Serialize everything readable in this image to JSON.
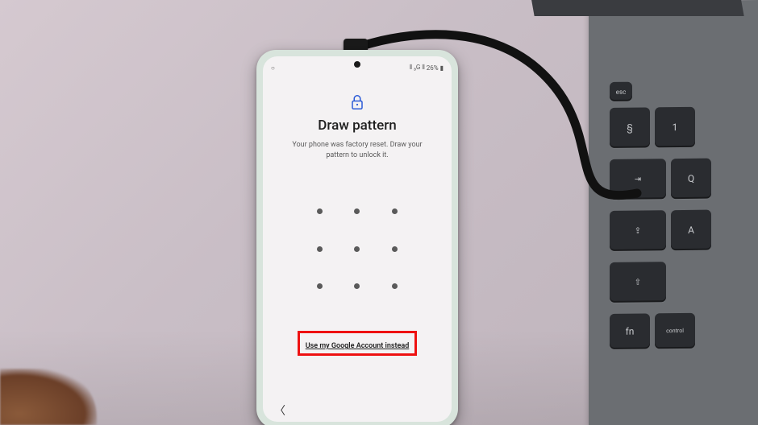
{
  "statusbar": {
    "time": "",
    "signal": "⫴ ₃G ⫴",
    "battery_pct": "26%",
    "battery_icon": "▮"
  },
  "lock_screen": {
    "title": "Draw pattern",
    "subtitle_line1": "Your phone was factory reset. Draw your",
    "subtitle_line2": "pattern to unlock it.",
    "alt_link": "Use my Google Account instead"
  },
  "keyboard": {
    "esc": "esc",
    "sect": "§",
    "tab": "⇥",
    "caps": "⇪",
    "shift": "⇧",
    "fn": "fn",
    "ctrl": "control",
    "digit1": "1",
    "q": "Q",
    "a": "A"
  },
  "icon_names": {
    "lock": "lock-icon",
    "back": "back-chevron-icon"
  }
}
